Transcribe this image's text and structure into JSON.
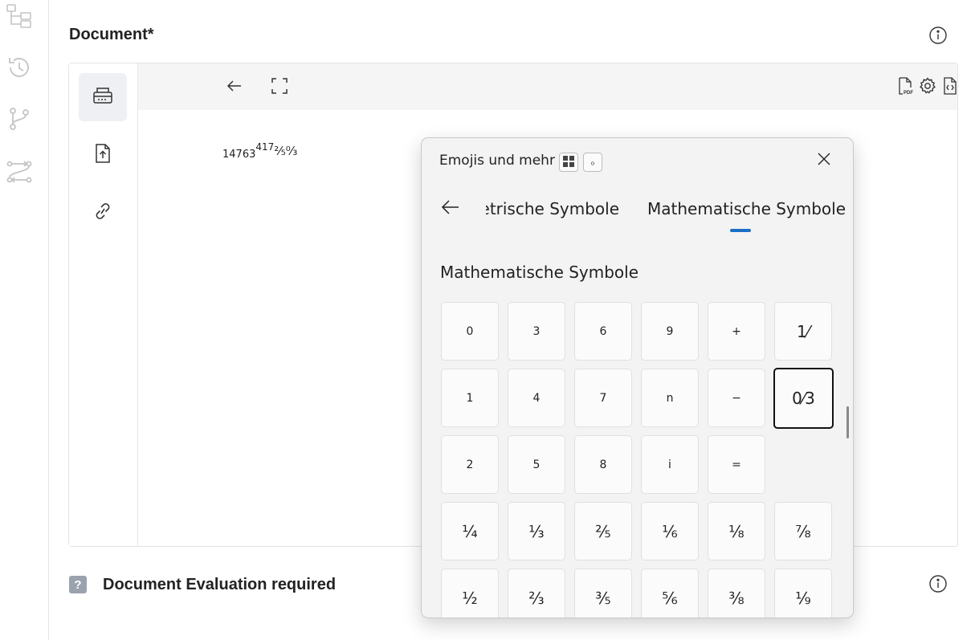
{
  "page": {
    "document_title": "Document*",
    "evaluation_label": "Document Evaluation required",
    "evaluation_badge": "?"
  },
  "left_rail": {
    "icons": [
      "hierarchy-icon",
      "history-icon",
      "branch-icon",
      "workflow-icon"
    ]
  },
  "side_tools": {
    "buttons": [
      "keyboard-input-icon",
      "upload-file-icon",
      "link-icon"
    ]
  },
  "toolbar": {
    "left": [
      "back-arrow-icon",
      "fullscreen-icon"
    ],
    "right": [
      "pdf-file-icon",
      "code-file-icon",
      "settings-icon"
    ],
    "pdf_badge": "PDF"
  },
  "document_content": {
    "base": "14763",
    "sup": "417",
    "frac": "⅖⁰⁄₃"
  },
  "emoji_panel": {
    "title": "Emojis und mehr",
    "mini_button_1": "⊞",
    "mini_button_2": "ₒ",
    "tab_previous": "Geometrische Symbole",
    "tab_previous_visible": "ıetrische Symbole",
    "tab_active": "Mathematische Symbole",
    "section_title": "Mathematische Symbole",
    "accent_color": "#1a6ec7",
    "rows": [
      [
        "0",
        "3",
        "6",
        "9",
        "+",
        "1⁄"
      ],
      [
        "1",
        "4",
        "7",
        "n",
        "−",
        "0⁄3"
      ],
      [
        "2",
        "5",
        "8",
        "i",
        "=",
        ""
      ],
      [
        "¼",
        "⅓",
        "⅖",
        "⅙",
        "⅛",
        "⅞"
      ],
      [
        "½",
        "⅔",
        "⅗",
        "⅚",
        "⅜",
        "⅑"
      ]
    ],
    "selected_symbol": "0⁄3"
  }
}
